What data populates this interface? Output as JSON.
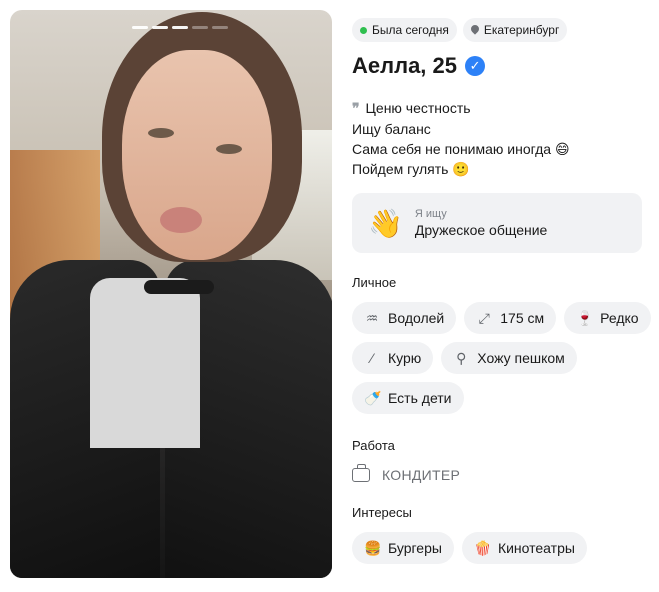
{
  "status": {
    "online_text": "Была сегодня",
    "city": "Екатеринбург",
    "online_color": "#2fbf4f"
  },
  "profile": {
    "name_age": "Аелла, 25",
    "verified_icon": "verified-check-icon",
    "accent": "#2d81f7"
  },
  "photo": {
    "page_dots": 5,
    "active_dots": 3
  },
  "bio": [
    "Ценю честность",
    "Ищу баланс",
    "Сама себя не понимаю иногда 😄",
    "Пойдем гулять 🙂"
  ],
  "seeking": {
    "label": "Я ищу",
    "value": "Дружеское общение",
    "icon": "👋"
  },
  "personal": {
    "title": "Личное",
    "items": [
      {
        "icon": "zodiac-icon",
        "glyph": "♒",
        "label": "Водолей"
      },
      {
        "icon": "height-icon",
        "glyph": "⤢",
        "label": "175 см"
      },
      {
        "icon": "wine-glass-icon",
        "glyph": "🍷",
        "label": "Редко"
      },
      {
        "icon": "smoking-icon",
        "glyph": "⁄",
        "label": "Курю"
      },
      {
        "icon": "dumbbell-icon",
        "glyph": "⚲",
        "label": "Хожу пешком"
      },
      {
        "icon": "baby-bottle-icon",
        "glyph": "🍼",
        "label": "Есть дети"
      }
    ]
  },
  "work": {
    "title": "Работа",
    "value": "КОНДИТЕР"
  },
  "interests": {
    "title": "Интересы",
    "items": [
      {
        "icon": "burger-icon",
        "glyph": "🍔",
        "label": "Бургеры"
      },
      {
        "icon": "popcorn-icon",
        "glyph": "🍿",
        "label": "Кинотеатры"
      }
    ]
  }
}
